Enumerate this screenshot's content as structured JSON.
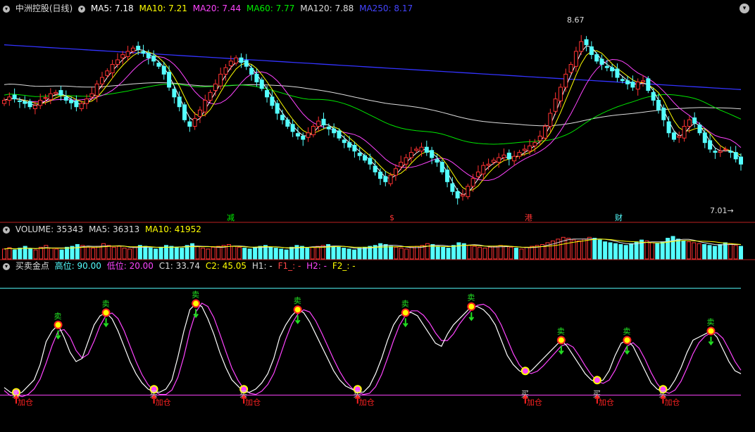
{
  "panel_price": {
    "title": "中洲控股(日线)",
    "ma5": "MA5: 7.18",
    "ma10": "MA10: 7.21",
    "ma20": "MA20: 7.44",
    "ma60": "MA60: 7.77",
    "ma120": "MA120: 7.88",
    "ma250": "MA250: 8.17",
    "high_label": "8.67",
    "low_label": "7.01",
    "markers": [
      "减",
      "$",
      "港",
      "财"
    ]
  },
  "panel_volume": {
    "volume": "VOLUME: 35343",
    "ma5": "MA5: 36313",
    "ma10": "MA10: 41952"
  },
  "panel_signal": {
    "title": "买卖金点",
    "high": "高位: 90.00",
    "low": "低位: 20.00",
    "c1": "C1: 33.74",
    "c2": "C2: 45.05",
    "h1": "H1: -",
    "f1": "F1_: -",
    "h2": "H2: -",
    "f2": "F2_: -",
    "sell_label": "卖",
    "buy_label": "买",
    "add_label": "加仓"
  },
  "colors": {
    "up": "#ff3232",
    "down": "#54ffff",
    "ma5": "#ffffff",
    "ma10": "#ffff00",
    "ma20": "#ff44ff",
    "ma60": "#00e600",
    "ma120": "#dddddd",
    "ma250": "#3333ff",
    "signal_k": "#ffffff",
    "signal_d": "#ff44ff",
    "sell": "#22dd22",
    "buy": "#ff2222",
    "level": "#ff44ff"
  },
  "chart_data": {
    "type": "candlestick",
    "close_series": [
      7.7,
      7.75,
      7.72,
      7.68,
      7.65,
      7.6,
      7.62,
      7.7,
      7.74,
      7.8,
      7.82,
      7.78,
      7.7,
      7.66,
      7.6,
      7.65,
      7.72,
      7.8,
      7.95,
      8.05,
      8.15,
      8.25,
      8.32,
      8.4,
      8.45,
      8.5,
      8.48,
      8.42,
      8.35,
      8.3,
      8.22,
      8.1,
      7.9,
      7.75,
      7.6,
      7.4,
      7.3,
      7.42,
      7.55,
      7.7,
      7.82,
      7.95,
      8.1,
      8.2,
      8.3,
      8.35,
      8.28,
      8.22,
      8.1,
      7.98,
      7.88,
      7.75,
      7.62,
      7.5,
      7.4,
      7.3,
      7.22,
      7.15,
      7.1,
      7.2,
      7.3,
      7.38,
      7.32,
      7.26,
      7.2,
      7.12,
      7.05,
      6.98,
      6.92,
      6.85,
      6.78,
      6.72,
      6.6,
      6.5,
      6.45,
      6.55,
      6.65,
      6.75,
      6.82,
      6.9,
      6.95,
      6.98,
      6.9,
      6.82,
      6.75,
      6.6,
      6.45,
      6.3,
      6.2,
      6.25,
      6.38,
      6.5,
      6.6,
      6.7,
      6.72,
      6.78,
      6.82,
      6.86,
      6.8,
      6.84,
      6.9,
      6.95,
      7.0,
      7.05,
      7.15,
      7.3,
      7.5,
      7.72,
      7.9,
      8.1,
      8.25,
      8.45,
      8.6,
      8.55,
      8.4,
      8.3,
      8.25,
      8.2,
      8.15,
      8.05,
      8.0,
      7.95,
      7.9,
      7.98,
      8.0,
      7.85,
      7.7,
      7.55,
      7.4,
      7.2,
      7.1,
      7.15,
      7.3,
      7.4,
      7.35,
      7.2,
      7.05,
      6.95,
      6.9,
      6.92,
      6.95,
      6.9,
      6.8,
      6.72
    ],
    "volume_series": [
      22,
      25,
      20,
      24,
      28,
      22,
      20,
      26,
      30,
      24,
      22,
      20,
      26,
      28,
      32,
      30,
      26,
      24,
      28,
      34,
      30,
      26,
      28,
      24,
      22,
      26,
      30,
      28,
      24,
      22,
      26,
      30,
      28,
      26,
      24,
      30,
      34,
      28,
      24,
      22,
      26,
      28,
      30,
      32,
      28,
      26,
      24,
      22,
      26,
      28,
      30,
      26,
      24,
      22,
      20,
      26,
      30,
      28,
      24,
      26,
      28,
      30,
      32,
      28,
      26,
      24,
      22,
      20,
      24,
      26,
      28,
      30,
      34,
      32,
      28,
      26,
      24,
      22,
      26,
      28,
      30,
      34,
      32,
      28,
      26,
      24,
      30,
      36,
      34,
      30,
      28,
      26,
      24,
      26,
      28,
      30,
      28,
      26,
      24,
      22,
      26,
      28,
      30,
      32,
      36,
      40,
      44,
      48,
      46,
      42,
      40,
      44,
      48,
      46,
      42,
      38,
      36,
      34,
      32,
      30,
      34,
      38,
      42,
      40,
      36,
      34,
      38,
      46,
      50,
      44,
      40,
      38,
      36,
      34,
      32,
      30,
      28,
      32,
      36,
      34,
      30,
      28
    ],
    "signal_k": [
      25,
      22,
      20,
      22,
      26,
      30,
      40,
      55,
      62,
      66,
      58,
      48,
      42,
      44,
      55,
      66,
      72,
      74,
      70,
      62,
      52,
      42,
      34,
      28,
      24,
      22,
      22,
      24,
      30,
      45,
      62,
      76,
      80,
      78,
      70,
      60,
      48,
      38,
      30,
      26,
      22,
      22,
      24,
      28,
      34,
      44,
      58,
      66,
      72,
      76,
      74,
      68,
      60,
      52,
      44,
      36,
      30,
      26,
      24,
      22,
      22,
      26,
      34,
      44,
      56,
      66,
      72,
      74,
      74,
      72,
      66,
      60,
      54,
      52,
      60,
      66,
      70,
      74,
      78,
      78,
      76,
      72,
      66,
      56,
      46,
      40,
      36,
      34,
      36,
      40,
      44,
      48,
      52,
      56,
      52,
      46,
      40,
      34,
      30,
      28,
      30,
      36,
      46,
      54,
      56,
      52,
      44,
      36,
      28,
      24,
      22,
      24,
      30,
      38,
      48,
      56,
      58,
      60,
      62,
      58,
      50,
      42,
      36,
      34
    ],
    "ylim_price": [
      6.0,
      9.0
    ],
    "ylim_signal": [
      0,
      100
    ],
    "level_high": 90,
    "level_low": 20
  }
}
